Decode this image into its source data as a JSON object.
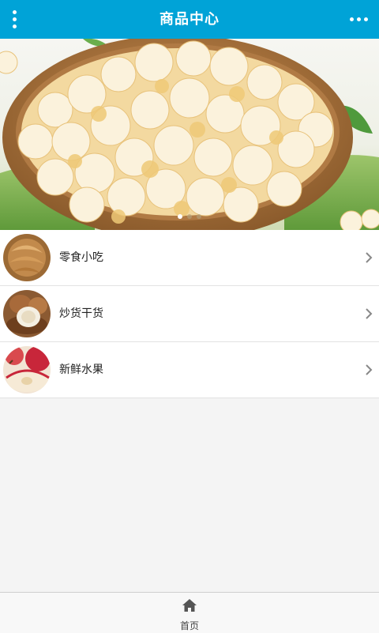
{
  "header": {
    "title": "商品中心",
    "menu_icon": "vertical-dots-icon",
    "more_icon": "horizontal-dots-icon",
    "background_color": "#00a3d7"
  },
  "banner": {
    "image": "popcorn-bowl-photo",
    "slide_count": 3,
    "active_slide": 1
  },
  "categories": [
    {
      "label": "零食小吃",
      "thumb": "snack-thumbnail",
      "icon": "chevron-right-icon"
    },
    {
      "label": "炒货干货",
      "thumb": "roasted-nuts-thumbnail",
      "icon": "chevron-right-icon"
    },
    {
      "label": "新鲜水果",
      "thumb": "fresh-fruit-thumbnail",
      "icon": "chevron-right-icon"
    }
  ],
  "bottom_nav": {
    "home_label": "首页",
    "home_icon": "home-icon"
  }
}
